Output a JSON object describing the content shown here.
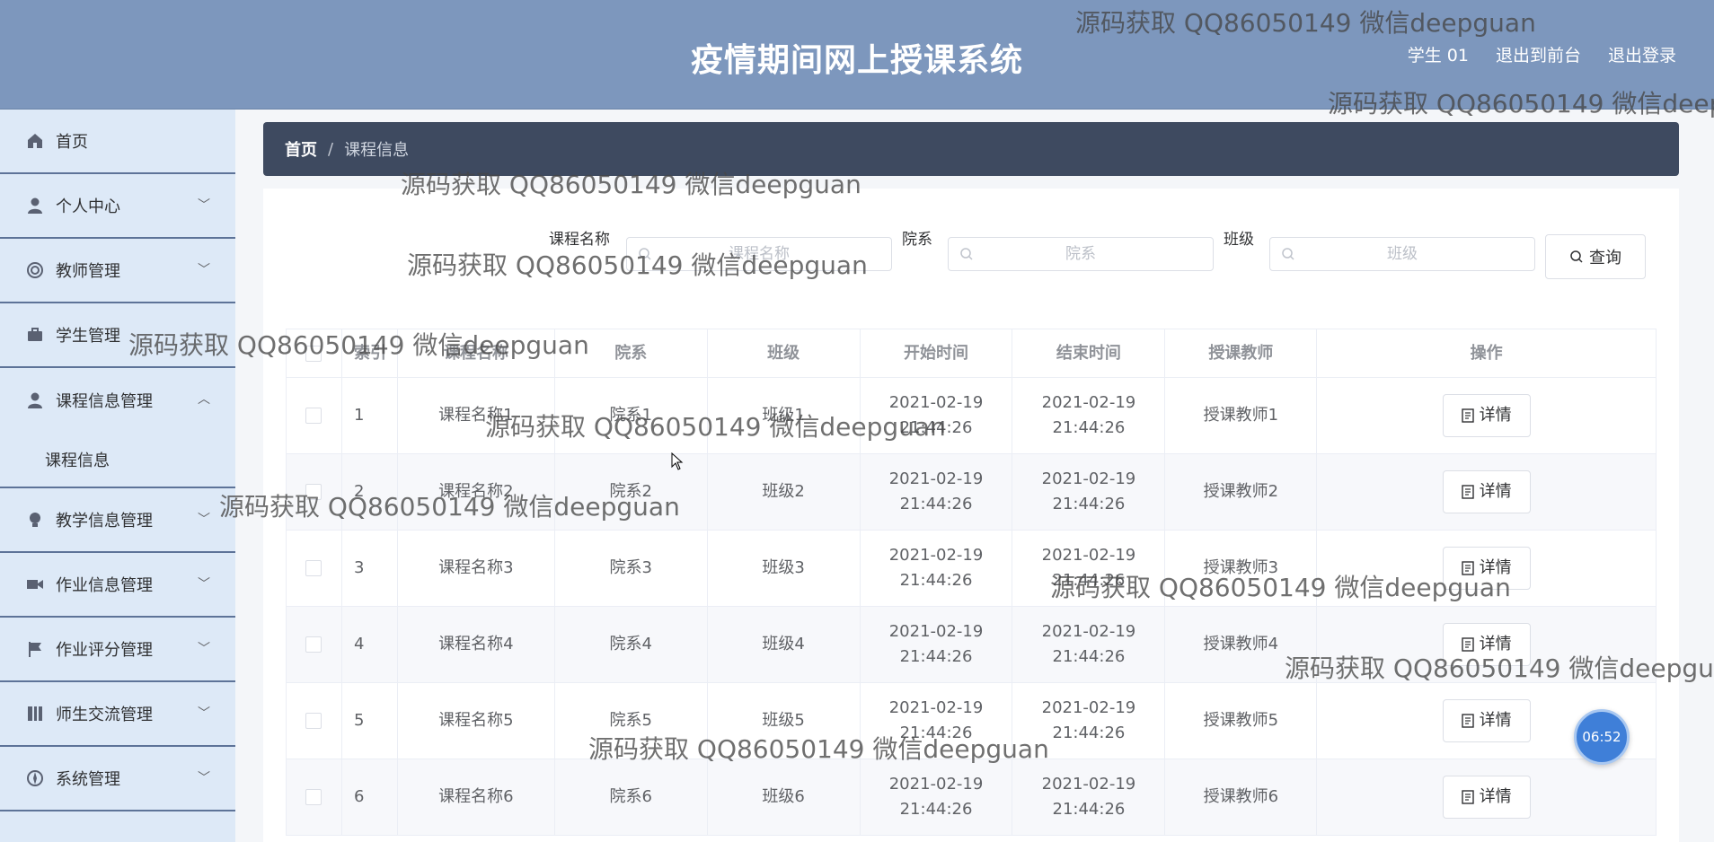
{
  "header": {
    "title": "疫情期间网上授课系统",
    "user": "学生 01",
    "back_to_front": "退出到前台",
    "logout": "退出登录"
  },
  "sidebar": {
    "items": [
      {
        "label": "首页",
        "icon": "home-icon"
      },
      {
        "label": "个人中心",
        "icon": "user-icon"
      },
      {
        "label": "教师管理",
        "icon": "lifebuoy-icon"
      },
      {
        "label": "学生管理",
        "icon": "briefcase-icon"
      },
      {
        "label": "课程信息管理",
        "icon": "user-icon"
      },
      {
        "label": "教学信息管理",
        "icon": "bulb-icon"
      },
      {
        "label": "作业信息管理",
        "icon": "video-camera-icon"
      },
      {
        "label": "作业评分管理",
        "icon": "flag-icon"
      },
      {
        "label": "师生交流管理",
        "icon": "notebook-icon"
      },
      {
        "label": "系统管理",
        "icon": "compass-icon"
      }
    ],
    "sub_item": "课程信息"
  },
  "breadcrumb": {
    "home": "首页",
    "separator": "/",
    "current": "课程信息"
  },
  "search": {
    "course_label": "课程名称",
    "course_placeholder": "课程名称",
    "dept_label": "院系",
    "dept_placeholder": "院系",
    "class_label": "班级",
    "class_placeholder": "班级",
    "query_button": "查询"
  },
  "table": {
    "headers": [
      "索引",
      "课程名称",
      "院系",
      "班级",
      "开始时间",
      "结束时间",
      "授课教师",
      "操作"
    ],
    "detail_button": "详情",
    "rows": [
      {
        "index": "1",
        "course": "课程名称1",
        "dept": "院系1",
        "class": "班级1",
        "start": "2021-02-19 21:44:26",
        "end": "2021-02-19 21:44:26",
        "teacher": "授课教师1"
      },
      {
        "index": "2",
        "course": "课程名称2",
        "dept": "院系2",
        "class": "班级2",
        "start": "2021-02-19 21:44:26",
        "end": "2021-02-19 21:44:26",
        "teacher": "授课教师2"
      },
      {
        "index": "3",
        "course": "课程名称3",
        "dept": "院系3",
        "class": "班级3",
        "start": "2021-02-19 21:44:26",
        "end": "2021-02-19 21:44:26",
        "teacher": "授课教师3"
      },
      {
        "index": "4",
        "course": "课程名称4",
        "dept": "院系4",
        "class": "班级4",
        "start": "2021-02-19 21:44:26",
        "end": "2021-02-19 21:44:26",
        "teacher": "授课教师4"
      },
      {
        "index": "5",
        "course": "课程名称5",
        "dept": "院系5",
        "class": "班级5",
        "start": "2021-02-19 21:44:26",
        "end": "2021-02-19 21:44:26",
        "teacher": "授课教师5"
      },
      {
        "index": "6",
        "course": "课程名称6",
        "dept": "院系6",
        "class": "班级6",
        "start": "2021-02-19 21:44:26",
        "end": "2021-02-19 21:44:26",
        "teacher": "授课教师6"
      }
    ]
  },
  "watermark": "源码获取 QQ86050149 微信deepguan",
  "timer": "06:52"
}
